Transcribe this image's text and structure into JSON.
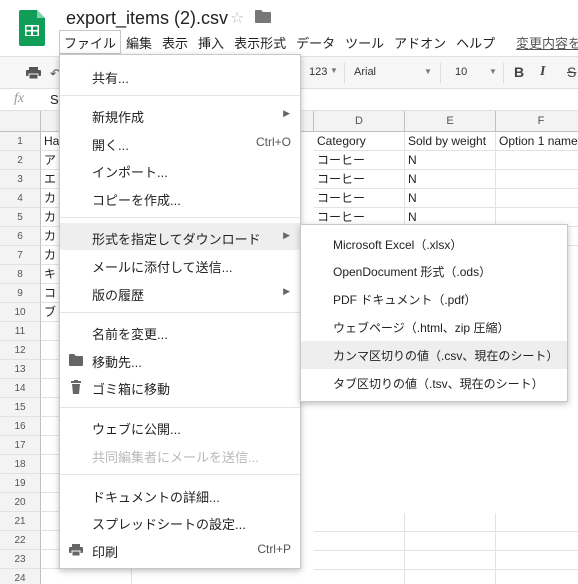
{
  "document": {
    "title": "export_items (2).csv"
  },
  "menubar": {
    "items": [
      "ファイル",
      "編集",
      "表示",
      "挿入",
      "表示形式",
      "データ",
      "ツール",
      "アドオン",
      "ヘルプ"
    ],
    "save_status": "変更内容を"
  },
  "toolbar": {
    "number_format": "123",
    "font": "Arial",
    "font_size": "10",
    "bold": "B",
    "italic": "I",
    "strike": "S"
  },
  "formula_bar": {
    "fx": "fx",
    "value": "S"
  },
  "grid": {
    "columns": [
      {
        "letter": ""
      },
      {
        "letter": ""
      },
      {
        "letter": ""
      },
      {
        "letter": "D"
      },
      {
        "letter": "E"
      },
      {
        "letter": "F"
      }
    ],
    "row_numbers": [
      "1",
      "2",
      "3",
      "4",
      "5",
      "6",
      "7",
      "8",
      "9",
      "10",
      "11",
      "12",
      "13",
      "14",
      "15",
      "16",
      "17",
      "18",
      "19",
      "20",
      "21",
      "22",
      "23",
      "24"
    ],
    "col_a_visible": [
      "Ha",
      "ア",
      "エ",
      "カ",
      "カ",
      "カ",
      "カ",
      "キ",
      "コ",
      "ブ"
    ],
    "rows": [
      {
        "D": "Category",
        "E": "Sold by weight",
        "F": "Option 1 name"
      },
      {
        "D": "コーヒー",
        "E": "N",
        "F": ""
      },
      {
        "D": "コーヒー",
        "E": "N",
        "F": ""
      },
      {
        "D": "コーヒー",
        "E": "N",
        "F": ""
      },
      {
        "D": "コーヒー",
        "E": "N",
        "F": ""
      }
    ]
  },
  "file_menu": {
    "items": [
      {
        "label": "共有...",
        "shortcut": "",
        "submenu": false,
        "disabled": false,
        "icon": ""
      },
      {
        "label": "新規作成",
        "shortcut": "",
        "submenu": true,
        "disabled": false,
        "icon": ""
      },
      {
        "label": "開く...",
        "shortcut": "Ctrl+O",
        "submenu": false,
        "disabled": false,
        "icon": ""
      },
      {
        "label": "インポート...",
        "shortcut": "",
        "submenu": false,
        "disabled": false,
        "icon": ""
      },
      {
        "label": "コピーを作成...",
        "shortcut": "",
        "submenu": false,
        "disabled": false,
        "icon": ""
      },
      {
        "label": "形式を指定してダウンロード",
        "shortcut": "",
        "submenu": true,
        "disabled": false,
        "icon": "",
        "highlighted": true
      },
      {
        "label": "メールに添付して送信...",
        "shortcut": "",
        "submenu": false,
        "disabled": false,
        "icon": ""
      },
      {
        "label": "版の履歴",
        "shortcut": "",
        "submenu": true,
        "disabled": false,
        "icon": ""
      },
      {
        "label": "名前を変更...",
        "shortcut": "",
        "submenu": false,
        "disabled": false,
        "icon": ""
      },
      {
        "label": "移動先...",
        "shortcut": "",
        "submenu": false,
        "disabled": false,
        "icon": "folder-icon"
      },
      {
        "label": "ゴミ箱に移動",
        "shortcut": "",
        "submenu": false,
        "disabled": false,
        "icon": "trash-icon"
      },
      {
        "label": "ウェブに公開...",
        "shortcut": "",
        "submenu": false,
        "disabled": false,
        "icon": ""
      },
      {
        "label": "共同編集者にメールを送信...",
        "shortcut": "",
        "submenu": false,
        "disabled": true,
        "icon": ""
      },
      {
        "label": "ドキュメントの詳細...",
        "shortcut": "",
        "submenu": false,
        "disabled": false,
        "icon": ""
      },
      {
        "label": "スプレッドシートの設定...",
        "shortcut": "",
        "submenu": false,
        "disabled": false,
        "icon": ""
      },
      {
        "label": "印刷",
        "shortcut": "Ctrl+P",
        "submenu": false,
        "disabled": false,
        "icon": "print-icon"
      }
    ]
  },
  "download_submenu": {
    "items": [
      {
        "label": "Microsoft Excel（.xlsx）"
      },
      {
        "label": "OpenDocument 形式（.ods）"
      },
      {
        "label": "PDF ドキュメント（.pdf）"
      },
      {
        "label": "ウェブページ（.html、zip 圧縮）"
      },
      {
        "label": "カンマ区切りの値（.csv、現在のシート）",
        "highlighted": true
      },
      {
        "label": "タブ区切りの値（.tsv、現在のシート）"
      }
    ]
  },
  "colors": {
    "sheets_green": "#0f9d58",
    "menu_highlight": "#eeeeee",
    "disabled_text": "#b8b8b8"
  }
}
